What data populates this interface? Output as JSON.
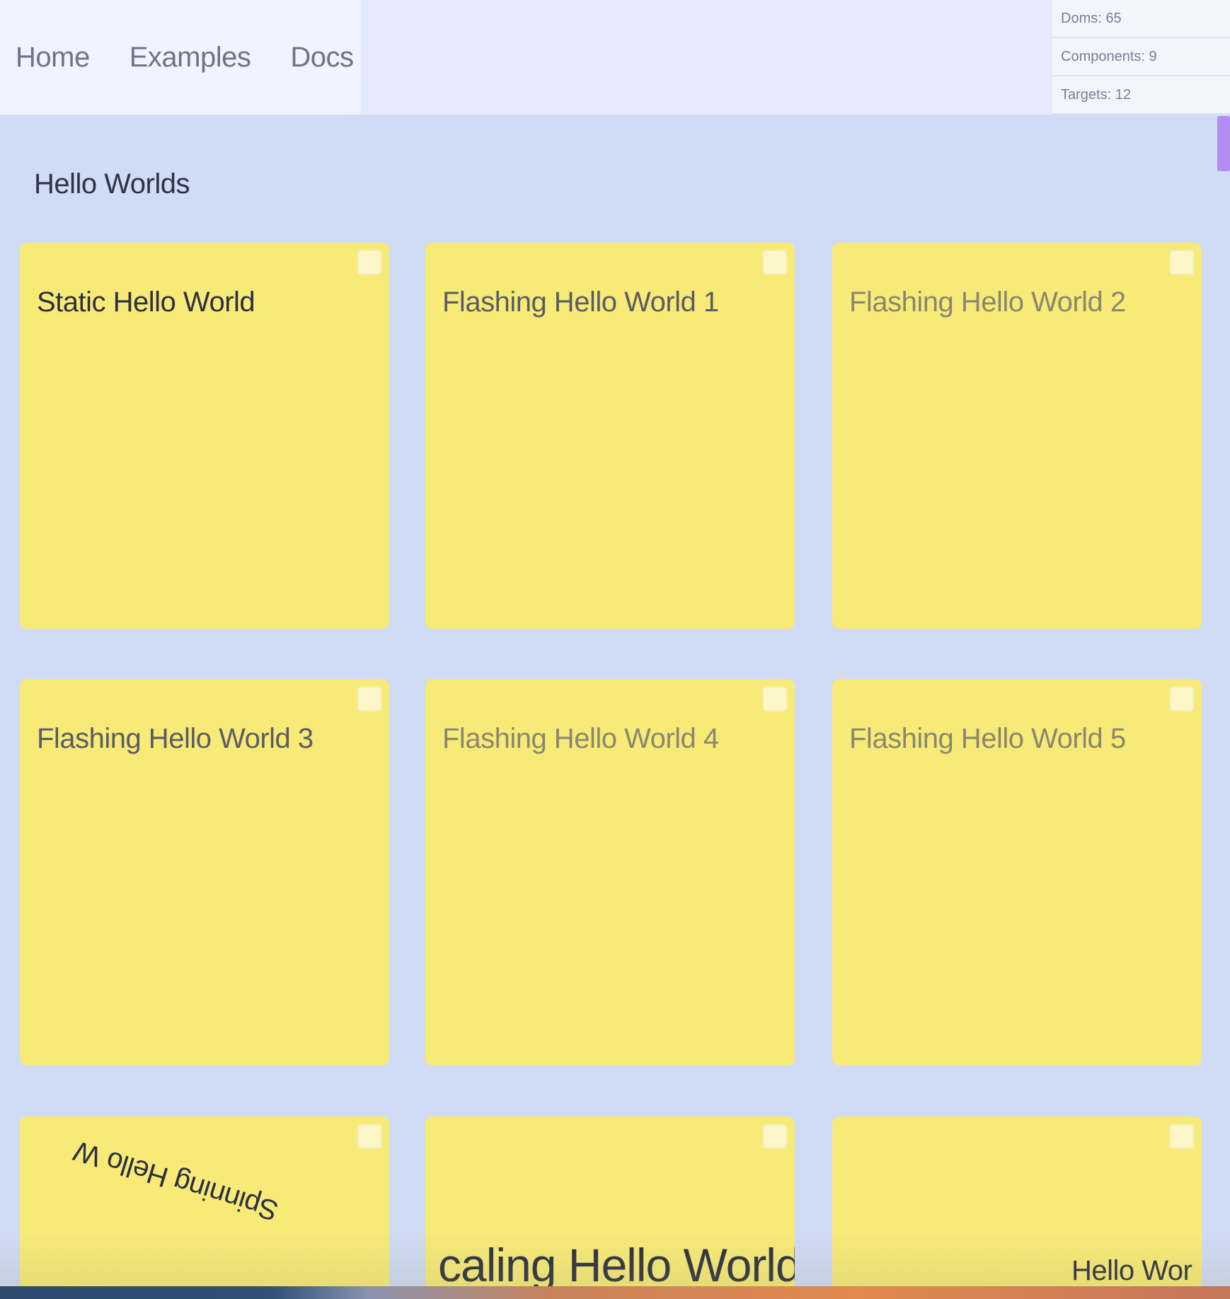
{
  "nav": {
    "items": [
      {
        "label": "Home"
      },
      {
        "label": "Examples"
      },
      {
        "label": "Docs"
      }
    ]
  },
  "stats": {
    "doms": "Doms: 65",
    "components": "Components: 9",
    "targets": "Targets: 12"
  },
  "section": {
    "title": "Hello Worlds"
  },
  "cards": [
    {
      "title": "Static Hello World"
    },
    {
      "title": "Flashing Hello World 1"
    },
    {
      "title": "Flashing Hello World 2"
    },
    {
      "title": "Flashing Hello World 3"
    },
    {
      "title": "Flashing Hello World 4"
    },
    {
      "title": "Flashing Hello World 5"
    },
    {
      "title": "Spinning Hello W"
    },
    {
      "title": "caling Hello World"
    },
    {
      "title": "Hello Wor"
    }
  ],
  "colors": {
    "page_bg": "#d0dbf5",
    "card_bg": "#f8ea77",
    "scroll_thumb": "#b38cf2"
  }
}
